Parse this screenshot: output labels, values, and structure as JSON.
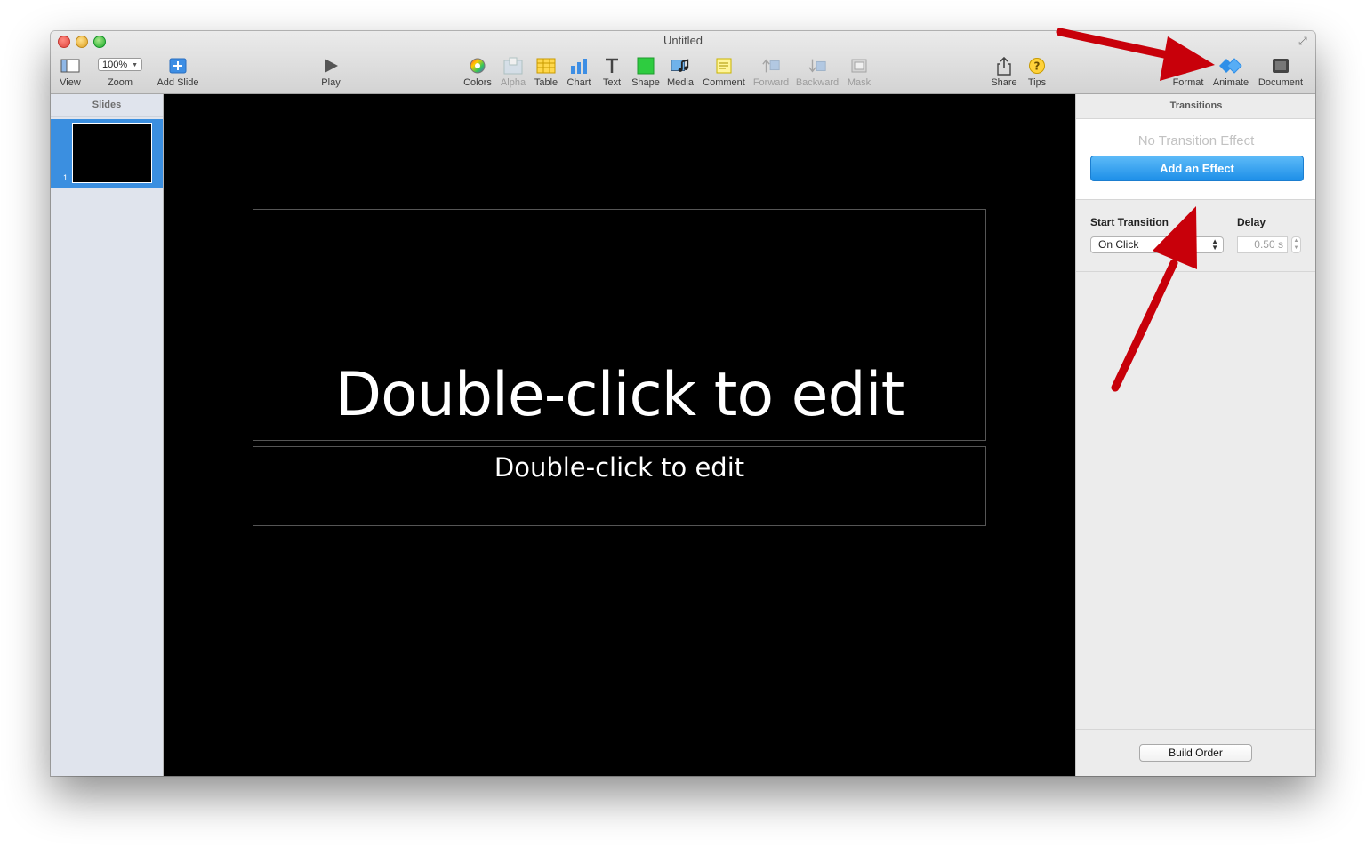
{
  "window": {
    "title": "Untitled"
  },
  "toolbar": {
    "view": "View",
    "zoom_value": "100%",
    "zoom": "Zoom",
    "add_slide": "Add Slide",
    "play": "Play",
    "colors": "Colors",
    "alpha": "Alpha",
    "table": "Table",
    "chart": "Chart",
    "text": "Text",
    "shape": "Shape",
    "media": "Media",
    "comment": "Comment",
    "forward": "Forward",
    "backward": "Backward",
    "mask": "Mask",
    "share": "Share",
    "tips": "Tips",
    "format": "Format",
    "animate": "Animate",
    "document": "Document"
  },
  "slides_panel": {
    "header": "Slides",
    "slides": [
      {
        "number": "1"
      }
    ]
  },
  "canvas": {
    "title_placeholder": "Double-click to edit",
    "subtitle_placeholder": "Double-click to edit"
  },
  "inspector": {
    "header": "Transitions",
    "no_effect": "No Transition Effect",
    "add_effect": "Add an Effect",
    "start_transition_label": "Start Transition",
    "start_transition_value": "On Click",
    "delay_label": "Delay",
    "delay_value": "0.50 s",
    "build_order": "Build Order"
  },
  "colors": {
    "accent": "#1d8fe8",
    "selection": "#3b8fe0",
    "annotation_arrow": "#c8000a"
  }
}
